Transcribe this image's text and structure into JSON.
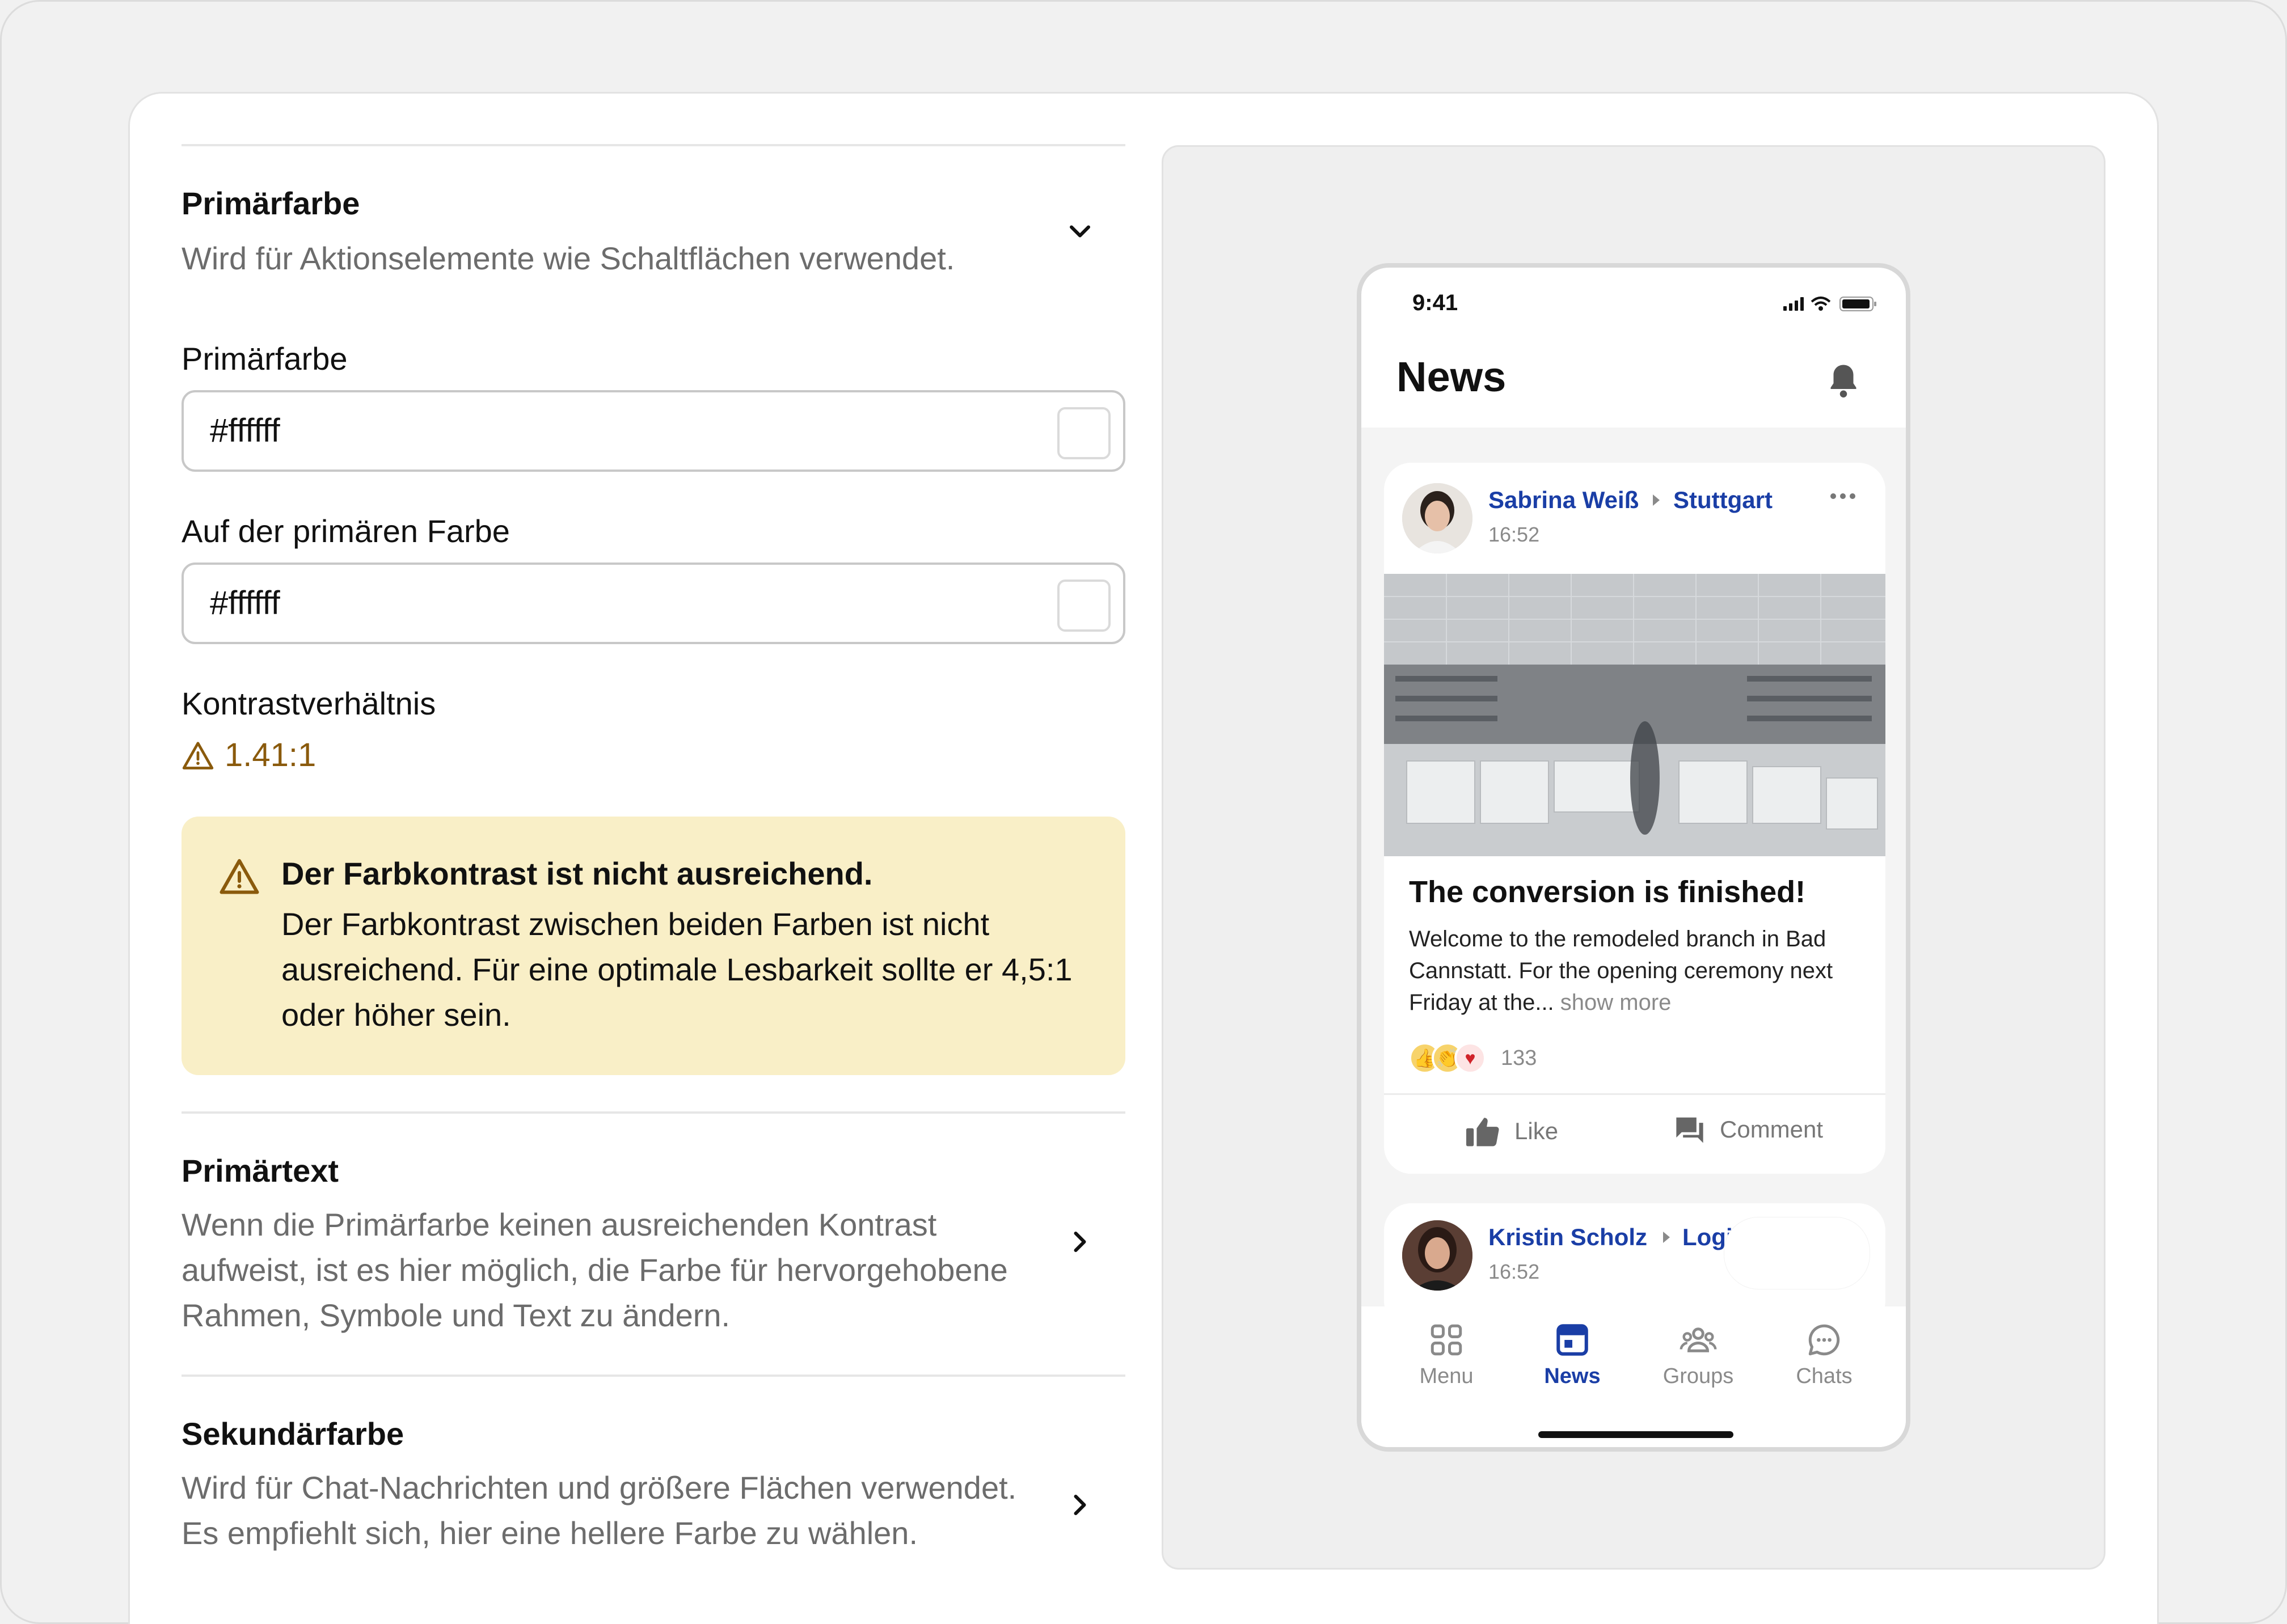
{
  "settings": {
    "primary_section": {
      "title": "Primärfarbe",
      "description": "Wird für Aktionselemente wie Schaltflächen verwendet."
    },
    "primary_color_field": {
      "label": "Primärfarbe",
      "value": "#ffffff",
      "swatch_color": "#ffffff"
    },
    "on_primary_field": {
      "label": "Auf der primären Farbe",
      "value": "#ffffff",
      "swatch_color": "#ffffff"
    },
    "contrast": {
      "label": "Kontrastverhältnis",
      "value": "1.41:1"
    },
    "warning": {
      "title": "Der Farbkontrast ist nicht ausreichend.",
      "text": "Der Farbkontrast zwischen beiden Farben ist nicht ausreichend. Für eine optimale Lesbarkeit sollte er 4,5:1 oder höher sein."
    },
    "primary_text_section": {
      "title": "Primärtext",
      "description": "Wenn die Primärfarbe keinen ausreichenden Kontrast aufweist, ist es hier möglich, die Farbe für hervorgehobene Rahmen, Symbole und Text zu ändern."
    },
    "secondary_section": {
      "title": "Sekundärfarbe",
      "description": "Wird für Chat-Nachrichten und größere Flächen verwendet. Es empfiehlt sich, hier eine hellere Farbe zu wählen."
    }
  },
  "phone": {
    "status_time": "9:41",
    "title": "News",
    "post1": {
      "author": "Sabrina Weiß",
      "place": "Stuttgart",
      "time": "16:52",
      "title": "The conversion is finished!",
      "body": "Welcome to the remodeled branch in Bad Cannstatt. For the opening ceremony next Friday at the...",
      "show_more": "show more",
      "reaction_count": "133",
      "like_label": "Like",
      "comment_label": "Comment"
    },
    "post2": {
      "author": "Kristin Scholz",
      "place": "Logis",
      "time": "16:52"
    },
    "tabs": {
      "menu": "Menu",
      "news": "News",
      "groups": "Groups",
      "chats": "Chats"
    }
  },
  "colors": {
    "accent": "#1a3ea6",
    "warning_bg": "#f9efc7",
    "warning_text": "#8a5a0c"
  }
}
